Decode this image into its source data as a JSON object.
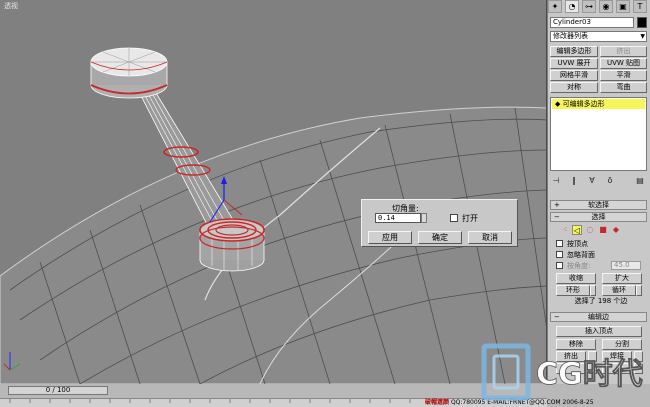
{
  "viewport": {
    "label": "透视"
  },
  "dialog": {
    "title_label": "切角量:",
    "amount_value": "0.14",
    "open_label": "打开",
    "apply_label": "应用",
    "ok_label": "确定",
    "cancel_label": "取消"
  },
  "panel": {
    "object_name": "Cylinder03",
    "object_color": "#000000",
    "modifier_list": "修改器列表",
    "buttons": {
      "edit_poly": "编辑多边形",
      "extrude_top": "挤出",
      "uvw_unwrap": "UVW 展开",
      "uvw_map": "UVW 贴图",
      "meshsmooth": "网格平滑",
      "smooth": "平滑",
      "symmetry": "对称",
      "bend": "弯曲"
    },
    "stack_item": "可编辑多边形",
    "stack_highlight": "#f6f65a",
    "soft_select": "软选择",
    "selection": "选择",
    "by_vertex": "按顶点",
    "ignore_backfacing": "忽略背面",
    "by_angle": "按角度:",
    "angle_value": "45.0",
    "shrink": "收缩",
    "grow": "扩大",
    "ring": "环形",
    "loop": "循环",
    "selected_count": "选择了 198 个边",
    "edit_edges": "编辑边",
    "insert_vertex": "插入顶点",
    "remove": "移除",
    "split": "分割",
    "extrude": "挤出",
    "weld": "焊接"
  },
  "bottom": {
    "time_slider": "0 / 100",
    "status_user": "破帽遮颜",
    "status_text": "QQ:780095  E-MAIL:FRNET@QQ.COM  2006-8-25"
  },
  "watermark": {
    "text": "CG时代"
  },
  "icons": {
    "tabs": [
      "create-icon",
      "modify-icon",
      "hierarchy-icon",
      "motion-icon",
      "display-icon",
      "utilities-icon"
    ],
    "accent_red": "#c82828"
  }
}
